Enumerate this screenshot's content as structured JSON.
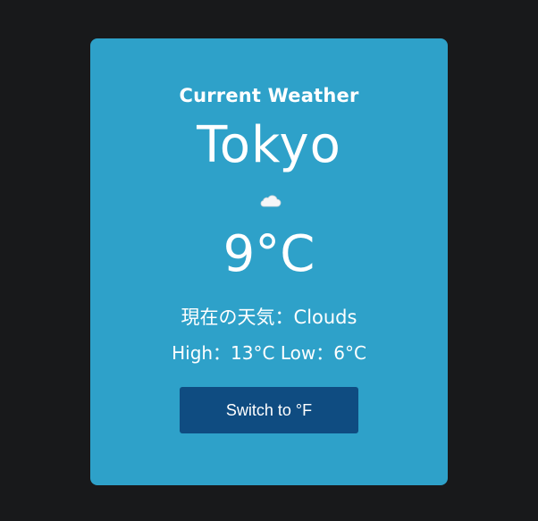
{
  "card": {
    "heading": "Current Weather",
    "city": "Tokyo",
    "icon": "cloud-icon",
    "temperature": "9°C",
    "condition": "現在の天気：Clouds",
    "high_low": "High：13°C Low：6°C",
    "switch_label": "Switch to °F"
  },
  "colors": {
    "background": "#18191b",
    "card": "#2ea1c9",
    "button": "#0f4c81",
    "text": "#ffffff"
  }
}
